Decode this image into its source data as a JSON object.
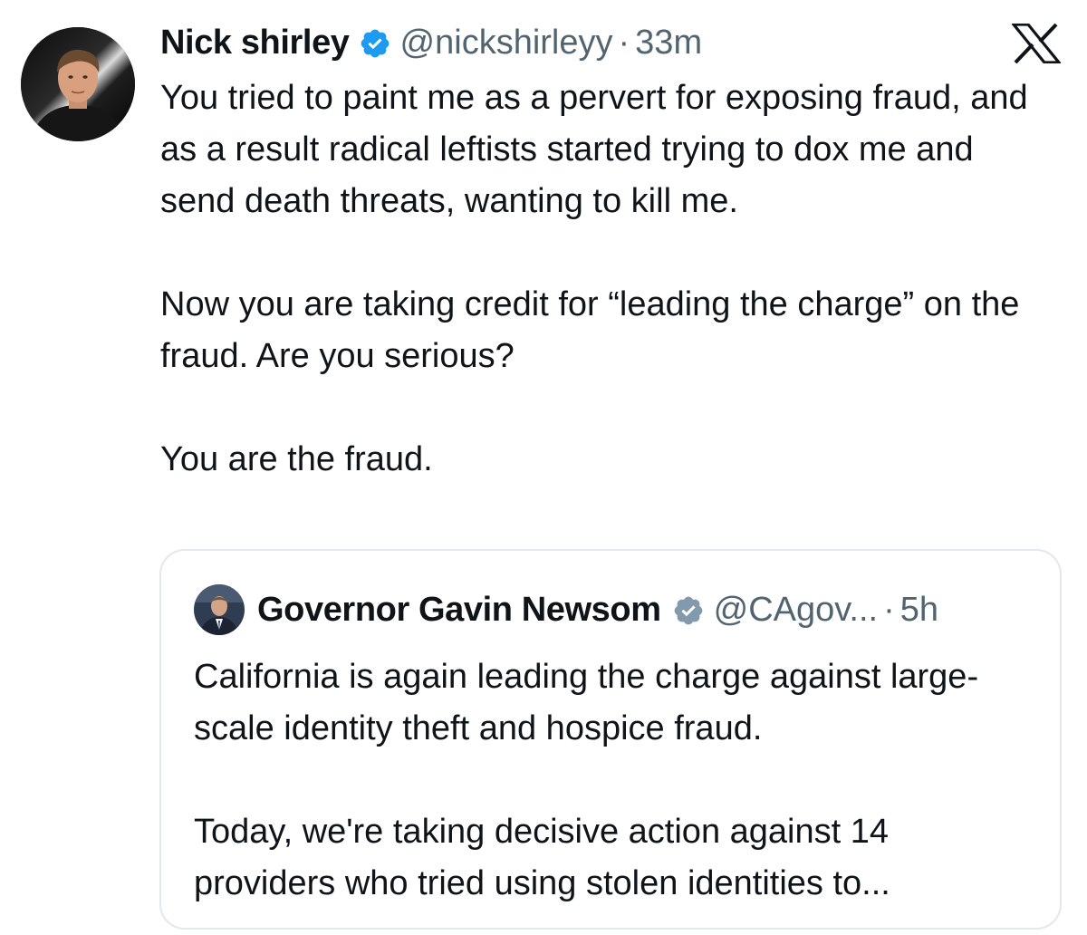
{
  "colors": {
    "text_primary": "#0f1419",
    "text_secondary": "#536471",
    "verified_blue": "#1d9bf0",
    "government_gray": "#829aab",
    "card_border": "#e3e8ec"
  },
  "platform": {
    "logo_icon": "x-logo-icon"
  },
  "tweet": {
    "author": {
      "display_name": "Nick shirley",
      "handle": "@nickshirleyy",
      "verified_badge": "verified-blue-icon",
      "avatar": "avatar-photo"
    },
    "separator": "·",
    "time": "33m",
    "paragraphs": [
      "You tried to paint me as a pervert for exposing fraud, and as a result radical leftists started trying to dox me and send death threats, wanting to kill me.",
      "Now you are taking credit for “leading the charge” on the fraud. Are you serious?",
      "You are the fraud."
    ]
  },
  "quoted_tweet": {
    "author": {
      "display_name": "Governor Gavin Newsom",
      "handle": "@CAgov...",
      "verified_badge": "government-verified-gray-icon",
      "avatar": "avatar-photo"
    },
    "separator": "·",
    "time": "5h",
    "paragraphs": [
      "California is again leading the charge against large-scale identity theft and hospice fraud.",
      "Today, we're taking decisive action against 14 providers who tried using stolen identities to..."
    ]
  }
}
